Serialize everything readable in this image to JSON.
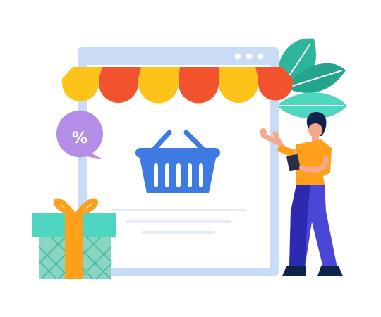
{
  "illustration": {
    "discount_badge": {
      "text": "%"
    },
    "colors": {
      "window_frame": "#c9dcf5",
      "window_dots": "#ffffff",
      "awning_yellow": "#fcc419",
      "awning_orange": "#f0532d",
      "basket": "#3d7be3",
      "badge": "#b48ee6",
      "gift_box": "#4fd6c0",
      "gift_ribbon": "#ff9f1a",
      "leaf": "#2fb59c",
      "shirt": "#ff9f1a",
      "pants": "#4a47d6",
      "skin": "#f5a98a",
      "hair": "#10234a"
    }
  }
}
